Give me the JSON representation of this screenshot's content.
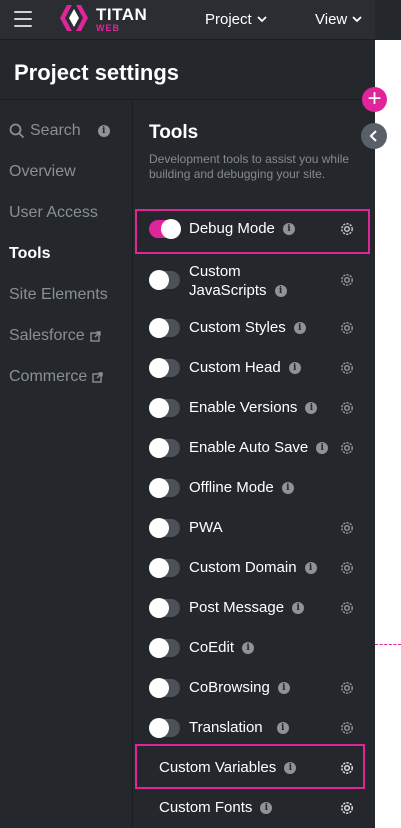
{
  "topbar": {
    "brand_name": "TITAN",
    "brand_sub": "WEB",
    "menus": [
      {
        "label": "Project"
      },
      {
        "label": "View"
      }
    ]
  },
  "panel": {
    "title": "Project settings"
  },
  "sidebar": {
    "search_label": "Search",
    "items": [
      {
        "label": "Overview"
      },
      {
        "label": "User Access"
      },
      {
        "label": "Tools"
      },
      {
        "label": "Site Elements"
      },
      {
        "label": "Salesforce"
      },
      {
        "label": "Commerce"
      }
    ]
  },
  "tools": {
    "title": "Tools",
    "description": "Development tools to assist you while building and debugging your site.",
    "items": [
      {
        "label": "Debug Mode",
        "enabled": true,
        "has_toggle": true,
        "has_gear": true
      },
      {
        "label_line1": "Custom",
        "label_line2": "JavaScripts",
        "enabled": false,
        "has_toggle": true,
        "has_gear": true
      },
      {
        "label": "Custom Styles",
        "enabled": false,
        "has_toggle": true,
        "has_gear": true
      },
      {
        "label": "Custom Head",
        "enabled": false,
        "has_toggle": true,
        "has_gear": true
      },
      {
        "label": "Enable Versions",
        "enabled": false,
        "has_toggle": true,
        "has_gear": true
      },
      {
        "label": "Enable Auto Save",
        "enabled": false,
        "has_toggle": true,
        "has_gear": true
      },
      {
        "label": "Offline Mode",
        "enabled": false,
        "has_toggle": true,
        "has_gear": false
      },
      {
        "label": "PWA",
        "enabled": false,
        "has_toggle": true,
        "has_gear": true
      },
      {
        "label": "Custom Domain",
        "enabled": false,
        "has_toggle": true,
        "has_gear": true
      },
      {
        "label": "Post Message",
        "enabled": false,
        "has_toggle": true,
        "has_gear": true
      },
      {
        "label": "CoEdit",
        "enabled": false,
        "has_toggle": true,
        "has_gear": false
      },
      {
        "label": "CoBrowsing",
        "enabled": false,
        "has_toggle": true,
        "has_gear": true
      },
      {
        "label": "Translation",
        "enabled": false,
        "has_toggle": true,
        "has_gear": true
      },
      {
        "label": "Custom Variables",
        "has_toggle": false,
        "has_gear": true
      },
      {
        "label": "Custom Fonts",
        "has_toggle": false,
        "has_gear": true
      }
    ]
  },
  "icons": {
    "info": "i",
    "plus": "+"
  },
  "colors": {
    "accent": "#e0249a",
    "background": "#24282c",
    "topbar": "#2a2e33"
  }
}
